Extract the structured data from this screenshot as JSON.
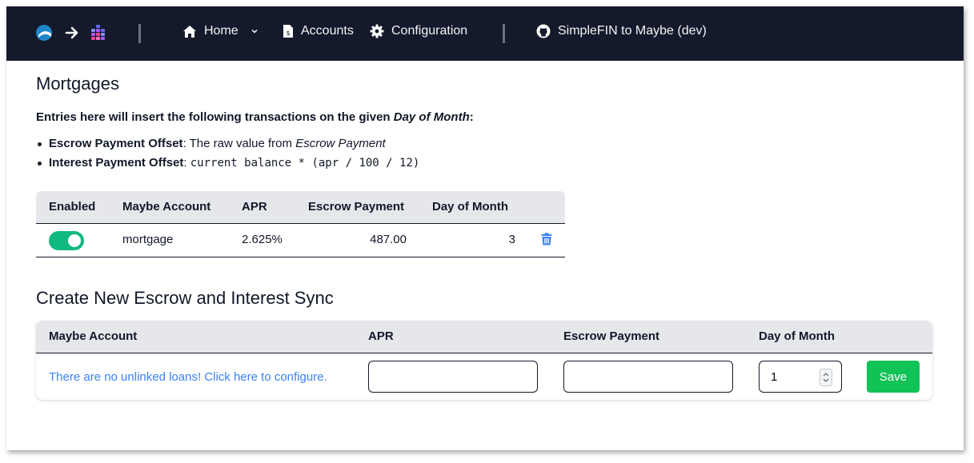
{
  "nav": {
    "home_label": "Home",
    "accounts_label": "Accounts",
    "configuration_label": "Configuration",
    "repo_label": "SimpleFIN to Maybe (dev)"
  },
  "page": {
    "title": "Mortgages",
    "intro_prefix": "Entries here will insert the following transactions on the given ",
    "intro_emph": "Day of Month",
    "intro_suffix": ":",
    "bullets": [
      {
        "bold": "Escrow Payment Offset",
        "sep": ": The raw value from ",
        "italic": "Escrow Payment"
      },
      {
        "bold": "Interest Payment Offset",
        "sep": ": ",
        "code": "current balance * (apr / 100 / 12)"
      }
    ]
  },
  "mortgages_table": {
    "headers": [
      "Enabled",
      "Maybe Account",
      "APR",
      "Escrow Payment",
      "Day of Month"
    ],
    "rows": [
      {
        "enabled": true,
        "account": "mortgage",
        "apr": "2.625%",
        "escrow": "487.00",
        "day": "3"
      }
    ]
  },
  "create_section": {
    "title": "Create New Escrow and Interest Sync",
    "headers": [
      "Maybe Account",
      "APR",
      "Escrow Payment",
      "Day of Month"
    ],
    "no_loans_link": "There are no unlinked loans! Click here to configure.",
    "apr_value": "",
    "escrow_value": "",
    "day_value": "1",
    "save_label": "Save"
  },
  "colors": {
    "navbar_bg": "#141a2b",
    "toggle_on": "#10b981",
    "save_button": "#10c356",
    "link": "#3b82f6",
    "delete_icon": "#3b82f6"
  }
}
